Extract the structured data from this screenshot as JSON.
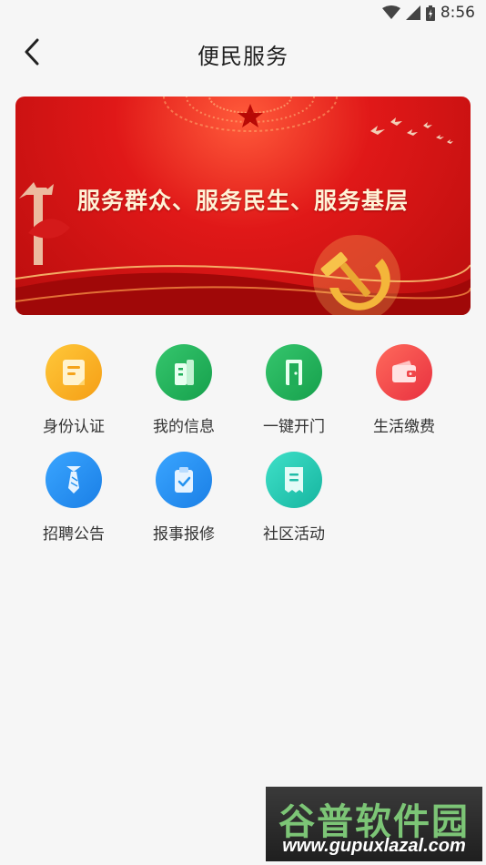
{
  "status_bar": {
    "time": "8:56",
    "icons": [
      "wifi-icon",
      "signal-icon",
      "battery-icon"
    ]
  },
  "header": {
    "title": "便民服务",
    "back_icon": "chevron-left-icon"
  },
  "banner": {
    "slogan": "服务群众、服务民生、服务基层"
  },
  "services": [
    {
      "label": "身份认证",
      "icon": "id-card-icon",
      "color": "#f9b020"
    },
    {
      "label": "我的信息",
      "icon": "building-icon",
      "color": "#21b15c"
    },
    {
      "label": "一键开门",
      "icon": "door-icon",
      "color": "#1fae56"
    },
    {
      "label": "生活缴费",
      "icon": "wallet-icon",
      "color": "#f0464a"
    },
    {
      "label": "招聘公告",
      "icon": "tie-icon",
      "color": "#2593f0"
    },
    {
      "label": "报事报修",
      "icon": "clipboard-check-icon",
      "color": "#2593f0"
    },
    {
      "label": "社区活动",
      "icon": "receipt-icon",
      "color": "#22c6b0"
    }
  ],
  "watermark": {
    "title": "谷普软件园",
    "url": "www.gupuxlazal.com"
  }
}
